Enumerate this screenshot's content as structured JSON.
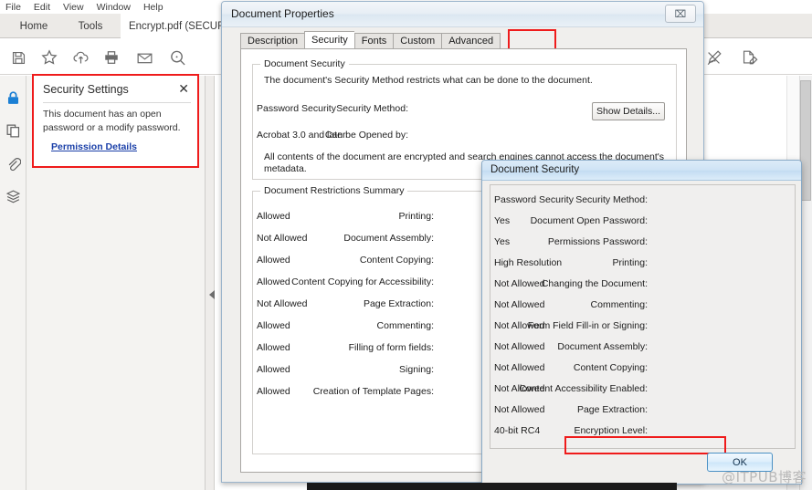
{
  "app": {
    "menubar": [
      "File",
      "Edit",
      "View",
      "Window",
      "Help"
    ],
    "tabs": {
      "home": "Home",
      "tools": "Tools",
      "document": "Encrypt.pdf (SECUR..."
    },
    "toolbar_icons": [
      "save-icon",
      "star-icon",
      "cloud-upload-icon",
      "print-icon",
      "email-icon",
      "search-icon",
      "sign-icon",
      "edit-document-icon"
    ],
    "rail_icons": [
      "lock-icon",
      "page-thumbnails-icon",
      "attachment-icon",
      "layers-icon"
    ],
    "accent_color": "#1b7fd4",
    "highlight_color": "#ef1b1b"
  },
  "security_settings_panel": {
    "title": "Security Settings",
    "close_label": "✕",
    "description": "This document has an open password or a modify password.",
    "link": "Permission Details"
  },
  "document_properties": {
    "title": "Document Properties",
    "close_label": "⌧",
    "tabs": [
      {
        "label": "Description",
        "active": false
      },
      {
        "label": "Security",
        "active": true
      },
      {
        "label": "Fonts",
        "active": false
      },
      {
        "label": "Custom",
        "active": false
      },
      {
        "label": "Advanced",
        "active": false
      }
    ],
    "document_security": {
      "legend": "Document Security",
      "intro": "The document's Security Method restricts what can be done to the document.",
      "security_method_label": "Security Method:",
      "security_method_value": "Password Security",
      "can_be_opened_label": "Can be Opened by:",
      "can_be_opened_value": "Acrobat 3.0 and later",
      "note_line1": "All contents of the document are encrypted and search engines cannot access the document's",
      "note_line2": "metadata.",
      "show_details_button": "Show Details..."
    },
    "restrictions": {
      "legend": "Document Restrictions Summary",
      "rows": [
        {
          "label": "Printing:",
          "value": "Allowed"
        },
        {
          "label": "Document Assembly:",
          "value": "Not Allowed"
        },
        {
          "label": "Content Copying:",
          "value": "Allowed"
        },
        {
          "label": "Content Copying for Accessibility:",
          "value": "Allowed"
        },
        {
          "label": "Page Extraction:",
          "value": "Not Allowed"
        },
        {
          "label": "Commenting:",
          "value": "Allowed"
        },
        {
          "label": "Filling of form fields:",
          "value": "Allowed"
        },
        {
          "label": "Signing:",
          "value": "Allowed"
        },
        {
          "label": "Creation of Template Pages:",
          "value": "Allowed"
        }
      ]
    }
  },
  "document_security_dialog": {
    "title": "Document Security",
    "rows": [
      {
        "label": "Security Method:",
        "value": "Password Security"
      },
      {
        "label": "Document Open Password:",
        "value": "Yes"
      },
      {
        "label": "Permissions Password:",
        "value": "Yes"
      },
      {
        "label": "Printing:",
        "value": "High Resolution"
      },
      {
        "label": "Changing the Document:",
        "value": "Not Allowed"
      },
      {
        "label": "Commenting:",
        "value": "Not Allowed"
      },
      {
        "label": "Form Field Fill-in or Signing:",
        "value": "Not Allowed"
      },
      {
        "label": "Document Assembly:",
        "value": "Not Allowed"
      },
      {
        "label": "Content Copying:",
        "value": "Not Allowed"
      },
      {
        "label": "Content Accessibility Enabled:",
        "value": "Not Allowed"
      },
      {
        "label": "Page Extraction:",
        "value": "Not Allowed"
      },
      {
        "label": "Encryption Level:",
        "value": "40-bit RC4"
      }
    ],
    "ok_button": "OK"
  },
  "watermark": "@ITPUB博客"
}
